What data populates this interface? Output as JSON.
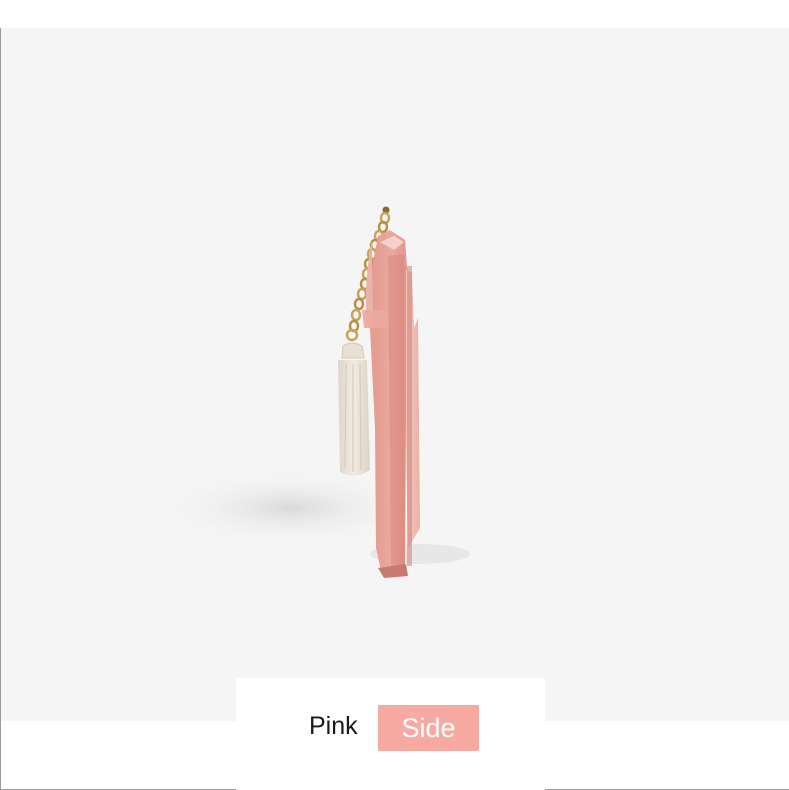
{
  "product": {
    "image_subject": "pink-card-wallet-side-view",
    "colors": {
      "background": "#f5f5f5",
      "wallet_pink": "#e9a9a0",
      "charm_cream": "#ece5da",
      "chain_gold": "#c9a35a"
    }
  },
  "caption": {
    "color_label": "Pink",
    "view_label": "Side",
    "view_tag_color": "#f7aaa1"
  }
}
